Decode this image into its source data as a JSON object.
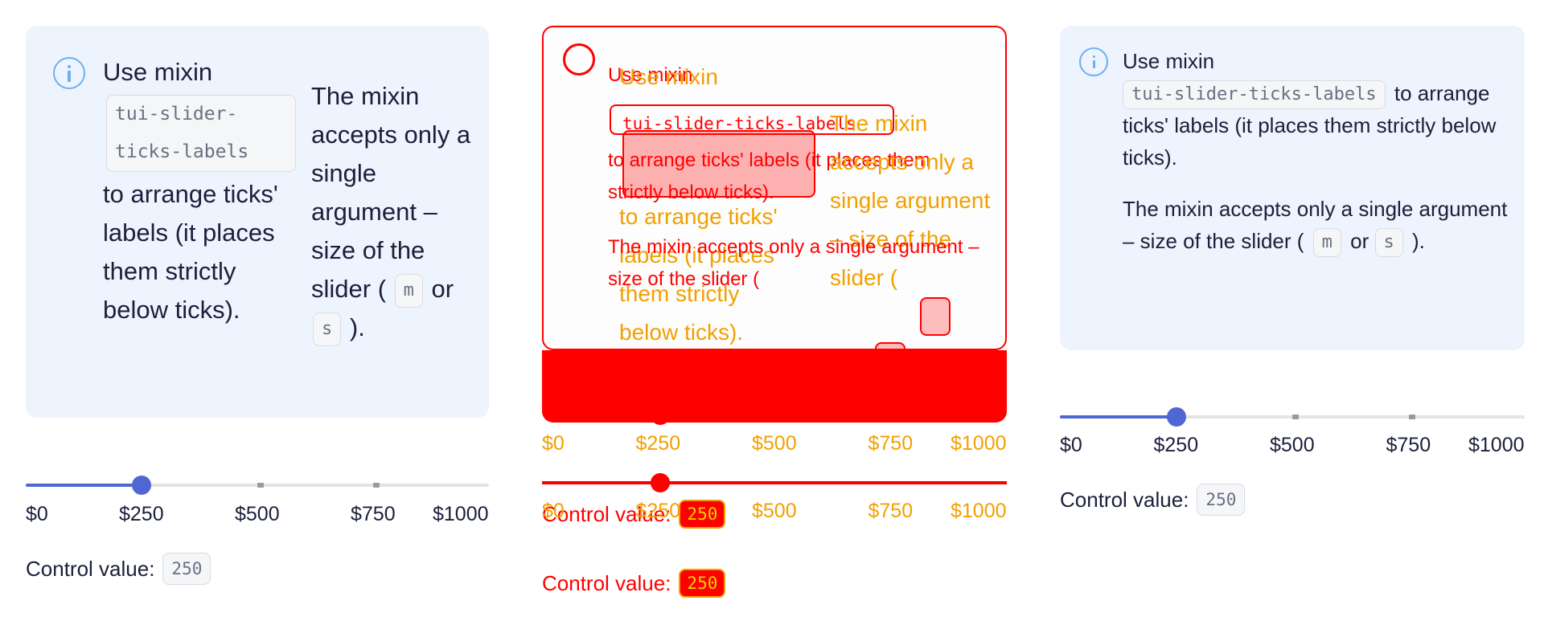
{
  "note": {
    "use_prefix": "Use mixin",
    "mixin_name_wrapped": "tui-slider-ticks-labels",
    "mixin_name": "tui-slider-ticks-labels",
    "arrange_text": "to arrange ticks' labels (it places them strictly below ticks).",
    "accepts_text": "The mixin accepts only a single argument – size of the slider (",
    "size_m": "m",
    "or_text": "or",
    "size_s": "s",
    "close_text": ")."
  },
  "slider": {
    "min": 0,
    "max": 1000,
    "value": 250,
    "labels": [
      "$0",
      "$250",
      "$500",
      "$750",
      "$1000"
    ]
  },
  "control": {
    "label": "Control value:",
    "value": "250"
  },
  "colors": {
    "accent": "#5066d2",
    "note_bg": "#edf4fd",
    "info_icon": "#6bb0f0",
    "diff_red": "#ff0000",
    "diff_yellow": "#f2a000"
  }
}
